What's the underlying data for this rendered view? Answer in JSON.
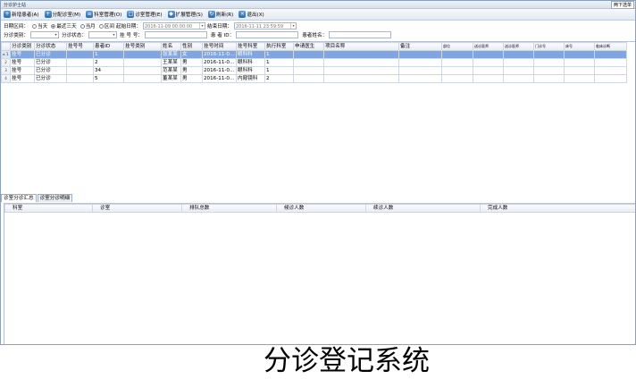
{
  "window": {
    "title": "分诊护士站",
    "corner_button": "两下选单"
  },
  "toolbar": [
    {
      "label": "新增患者(A)",
      "icon": "add-patient-icon",
      "glyph": "+"
    },
    {
      "label": "分配诊室(M)",
      "icon": "assign-room-icon",
      "glyph": "+"
    },
    {
      "label": "科室管理(O)",
      "icon": "department-icon",
      "glyph": "≡"
    },
    {
      "label": "诊室管理(E)",
      "icon": "clinic-room-icon",
      "glyph": "□"
    },
    {
      "label": "扩展管理(S)",
      "icon": "extension-icon",
      "glyph": "◆"
    },
    {
      "label": "刷新(R)",
      "icon": "refresh-icon",
      "glyph": "↻"
    },
    {
      "label": "退出(X)",
      "icon": "exit-icon",
      "glyph": "×"
    }
  ],
  "filters": {
    "date_range_label": "日期区间：",
    "date_options": [
      {
        "label": "当天",
        "checked": false
      },
      {
        "label": "最近三天",
        "checked": true
      },
      {
        "label": "当月",
        "checked": false
      },
      {
        "label": "区间",
        "checked": false
      }
    ],
    "start_label": "起始日期：",
    "start_value": "2016-11-09 00:00:00",
    "end_label": "结束日期：",
    "end_value": "2016-11-11 23:59:59",
    "category_label": "分诊类别：",
    "status_label": "分诊状态：",
    "reg_no_label": "挂 号 号：",
    "patient_id_label": "患 者 ID：",
    "patient_name_label": "患者姓名："
  },
  "grid": {
    "columns": [
      "分诊类别",
      "分诊状态",
      "挂号号",
      "患者ID",
      "挂号类别",
      "姓名",
      "性别",
      "挂号时间",
      "挂号科室",
      "执行科室",
      "申请医生",
      "项目名称",
      "备注",
      "部位",
      "送诊医师",
      "送诊医师",
      "门诊号",
      "床号",
      "临床诊断"
    ],
    "rows": [
      {
        "marker": "▸ 1",
        "cells": [
          "挂号",
          "已分诊",
          "",
          "1",
          "",
          "张某某",
          "女",
          "2016-11-0...",
          "眼科科",
          "1",
          "",
          "",
          "",
          "",
          "",
          "",
          "",
          "",
          ""
        ]
      },
      {
        "marker": "2",
        "cells": [
          "挂号",
          "已分诊",
          "",
          "2",
          "",
          "王某某",
          "男",
          "2016-11-0...",
          "眼科科",
          "1",
          "",
          "",
          "",
          "",
          "",
          "",
          "",
          "",
          ""
        ]
      },
      {
        "marker": "3",
        "cells": [
          "挂号",
          "已分诊",
          "",
          "34",
          "",
          "范某某",
          "男",
          "2016-11-0...",
          "眼科科",
          "1",
          "",
          "",
          "",
          "",
          "",
          "",
          "",
          "",
          ""
        ]
      },
      {
        "marker": "4",
        "cells": [
          "挂号",
          "已分诊",
          "",
          "5",
          "",
          "董某某",
          "男",
          "2016-11-0...",
          "内窥镜科",
          "2",
          "",
          "",
          "",
          "",
          "",
          "",
          "",
          "",
          ""
        ]
      }
    ]
  },
  "bottom_tabs": [
    "诊室分诊汇总",
    "诊室分诊明细"
  ],
  "bottom_grid": {
    "columns": [
      "科室",
      "诊室",
      "排队总数",
      "候诊人数",
      "续诊人数",
      "完成人数"
    ]
  },
  "caption": "分诊登记系统"
}
